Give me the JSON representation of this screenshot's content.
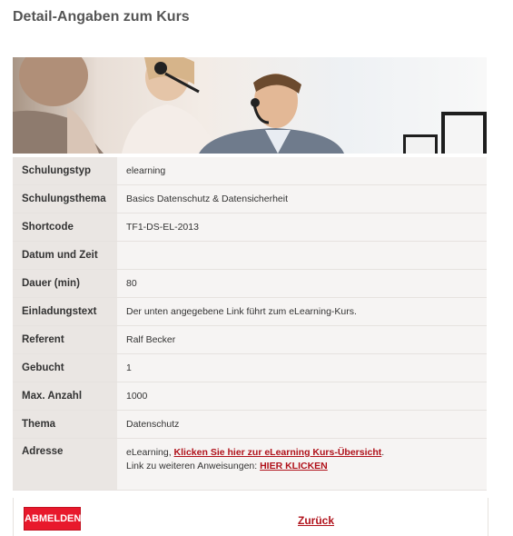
{
  "page_title": "Detail-Angaben zum Kurs",
  "details": [
    {
      "label": "Schulungstyp",
      "value": "elearning"
    },
    {
      "label": "Schulungsthema",
      "value": "Basics Datenschutz & Datensicherheit"
    },
    {
      "label": "Shortcode",
      "value": "TF1-DS-EL-2013"
    },
    {
      "label": "Datum und Zeit",
      "value": ""
    },
    {
      "label": "Dauer (min)",
      "value": "80"
    },
    {
      "label": "Einladungstext",
      "value": "Der unten angegebene Link führt zum eLearning-Kurs."
    },
    {
      "label": "Referent",
      "value": "Ralf Becker"
    },
    {
      "label": "Gebucht",
      "value": "1"
    },
    {
      "label": "Max. Anzahl",
      "value": "1000"
    },
    {
      "label": "Thema",
      "value": "Datenschutz"
    }
  ],
  "address": {
    "label": "Adresse",
    "prefix": "eLearning, ",
    "overview_link": "Klicken Sie hier zur eLearning Kurs-Übersicht",
    "suffix": ".",
    "line2_prefix": "Link zu weiteren Anweisungen: ",
    "instructions_link": "HIER KLICKEN"
  },
  "footer": {
    "abmelden_label": "ABMELDEN",
    "back_label": "Zurück"
  },
  "colors": {
    "accent_red": "#e8192c",
    "link_red": "#b0121b"
  }
}
